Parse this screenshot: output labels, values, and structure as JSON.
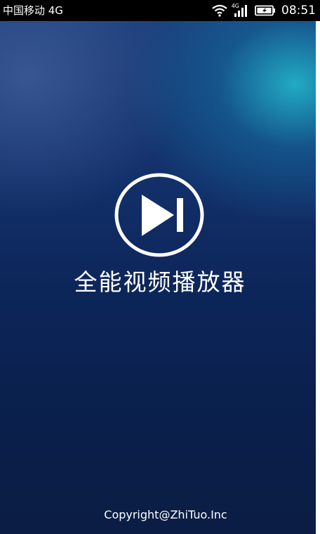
{
  "status_bar": {
    "carrier": "中国移动 4G",
    "network_type": "4G",
    "time": "08:51",
    "icons": [
      "wifi-icon",
      "signal-icon",
      "battery-charging-icon"
    ]
  },
  "splash": {
    "logo_icon": "play-next-icon",
    "title": "全能视频播放器",
    "copyright": "Copyright@ZhiTuo.Inc"
  },
  "colors": {
    "background_top": "#1c3d7a",
    "background_bottom": "#0b1d44",
    "accent_glow": "#22b1c8",
    "text": "#ffffff",
    "status_bar": "#000000"
  }
}
